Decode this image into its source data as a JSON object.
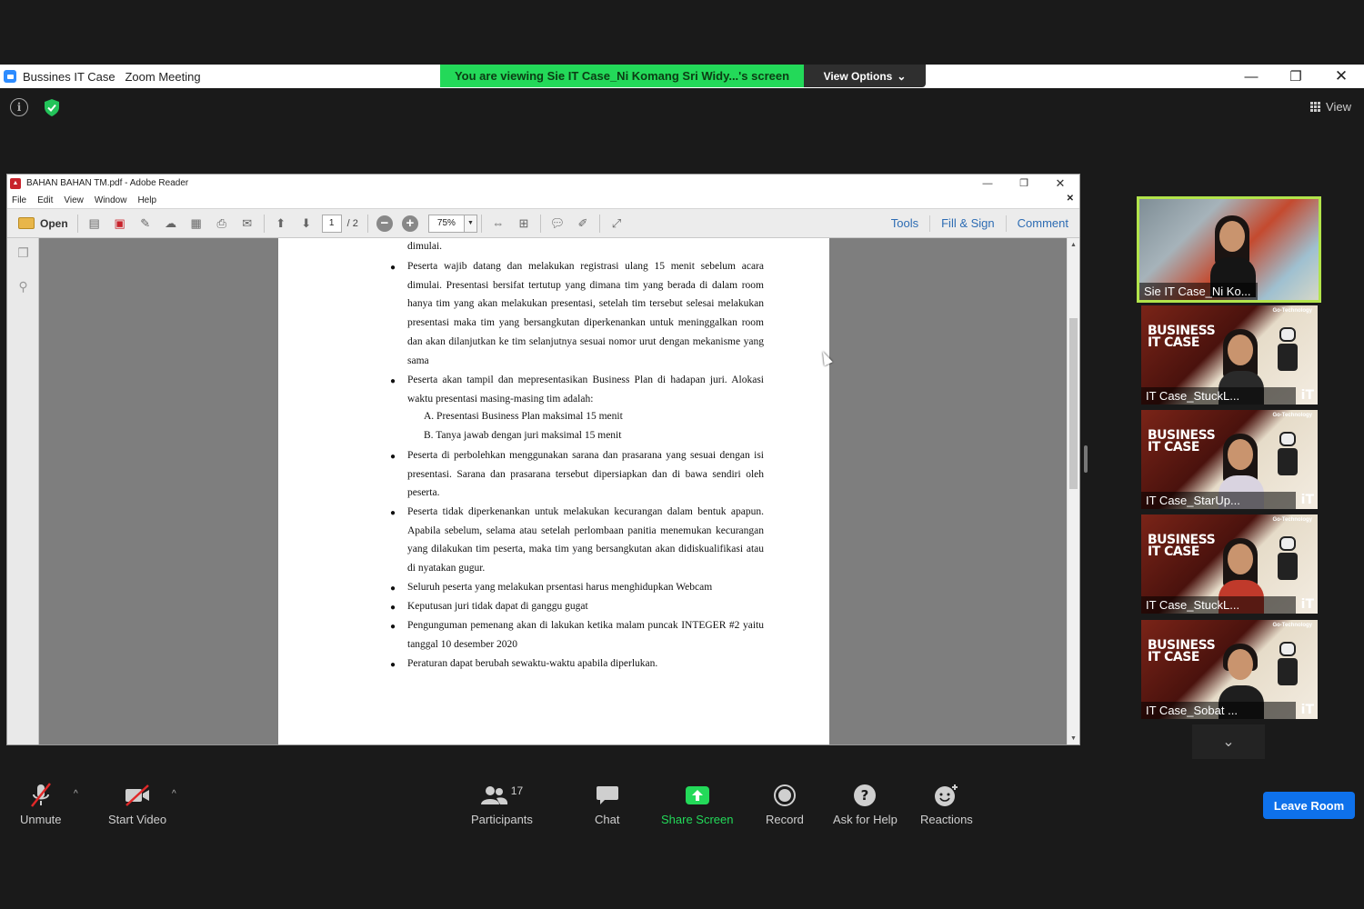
{
  "zoom": {
    "window_title": "Bussines IT Case   Zoom Meeting",
    "viewing_banner": "You are viewing Sie IT Case_Ni Komang Sri Widy...'s screen",
    "view_options": "View Options",
    "view_label": "View"
  },
  "adobe": {
    "title": "BAHAN BAHAN TM.pdf - Adobe Reader",
    "menu": [
      "File",
      "Edit",
      "View",
      "Window",
      "Help"
    ],
    "open_label": "Open",
    "page_current": "1",
    "page_total": "/ 2",
    "zoom_value": "75%",
    "tools_label": "Tools",
    "fill_sign_label": "Fill & Sign",
    "comment_label": "Comment"
  },
  "pdf": {
    "top_fragment": "dimulai.",
    "bullets": [
      "Peserta wajib datang dan melakukan registrasi ulang 15 menit sebelum acara dimulai. Presentasi bersifat tertutup yang dimana tim yang berada di dalam room hanya tim yang akan melakukan presentasi, setelah tim tersebut selesai melakukan presentasi maka tim yang bersangkutan diperkenankan untuk meninggalkan room dan akan dilanjutkan ke tim selanjutnya sesuai nomor urut dengan mekanisme yang sama",
      "Peserta akan tampil dan mepresentasikan Business Plan di hadapan juri. Alokasi waktu presentasi masing-masing tim adalah:",
      "Peserta di perbolehkan menggunakan sarana dan prasarana yang sesuai dengan isi presentasi. Sarana dan prasarana tersebut dipersiapkan dan di bawa sendiri oleh peserta.",
      "Peserta tidak diperkenankan untuk melakukan kecurangan dalam bentuk apapun. Apabila sebelum, selama atau setelah perlombaan panitia menemukan kecurangan yang dilakukan tim peserta, maka tim yang bersangkutan akan didiskualifikasi atau di nyatakan gugur.",
      "Seluruh peserta yang melakukan prsentasi harus menghidupkan Webcam",
      "Keputusan juri tidak dapat di ganggu gugat",
      "Pengunguman pemenang akan di lakukan ketika malam puncak INTEGER #2 yaitu tanggal 10 desember 2020",
      "Peraturan dapat berubah sewaktu-waktu apabila diperlukan."
    ],
    "sub_items": [
      "A.   Presentasi Business Plan maksimal 15 menit",
      "B.   Tanya jawab dengan juri maksimal 15 menit"
    ]
  },
  "participants": [
    {
      "name": "Sie IT Case_Ni Ko..."
    },
    {
      "name": "IT Case_StuckL..."
    },
    {
      "name": "IT Case_StarUp..."
    },
    {
      "name": "IT Case_StuckL..."
    },
    {
      "name": "IT Case_Sobat ..."
    }
  ],
  "tile_text": {
    "line1": "BUSINESS",
    "line2": "IT CASE",
    "brand": "Go-Technology",
    "corner": "iT"
  },
  "controls": {
    "unmute": "Unmute",
    "start_video": "Start Video",
    "participants": "Participants",
    "participants_count": "17",
    "chat": "Chat",
    "share_screen": "Share Screen",
    "record": "Record",
    "ask_help": "Ask for Help",
    "reactions": "Reactions",
    "leave_room": "Leave Room"
  },
  "colors": {
    "share_green": "#23d959",
    "leave_blue": "#0e71eb",
    "active_border": "#b2e44b"
  }
}
